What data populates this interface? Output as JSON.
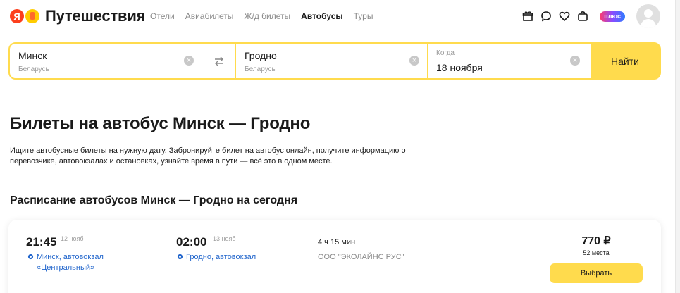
{
  "header": {
    "logo_letter": "Я",
    "logo_text": "Путешествия",
    "nav": [
      {
        "label": "Отели",
        "active": false
      },
      {
        "label": "Авиабилеты",
        "active": false
      },
      {
        "label": "Ж/д билеты",
        "active": false
      },
      {
        "label": "Автобусы",
        "active": true
      },
      {
        "label": "Туры",
        "active": false
      }
    ],
    "plus_label": "плюс"
  },
  "search": {
    "from": {
      "value": "Минск",
      "country": "Беларусь"
    },
    "to": {
      "value": "Гродно",
      "country": "Беларусь"
    },
    "date": {
      "label": "Когда",
      "value": "18 ноября"
    },
    "submit_label": "Найти",
    "clear_glyph": "×",
    "swap_glyph": "⇄"
  },
  "page": {
    "title": "Билеты на автобус Минск — Гродно",
    "description": "Ищите автобусные билеты на нужную дату. Забронируйте билет на автобус онлайн, получите информацию о перевозчике, автовокзалах и остановках, узнайте время в пути — всё это в одном месте.",
    "schedule_title": "Расписание автобусов Минск — Гродно на сегодня"
  },
  "trips": [
    {
      "departure_time": "21:45",
      "departure_date": "12 нояб",
      "departure_station": "Минск, автовокзал «Центральный»",
      "arrival_time": "02:00",
      "arrival_date": "13 нояб",
      "arrival_station": "Гродно, автовокзал",
      "duration": "4 ч 15 мин",
      "carrier": "ООО \"ЭКОЛАЙНС РУС\"",
      "price": "770 ₽",
      "seats": "52 места",
      "select_label": "Выбрать"
    }
  ],
  "colors": {
    "accent_yellow": "#ffdb4d",
    "logo_red": "#fc3f1d",
    "link_blue": "#2266cc"
  },
  "icons": [
    "gift-icon",
    "chat-icon",
    "heart-icon",
    "bag-icon",
    "map-pin-icon",
    "swap-icon",
    "clear-icon"
  ]
}
